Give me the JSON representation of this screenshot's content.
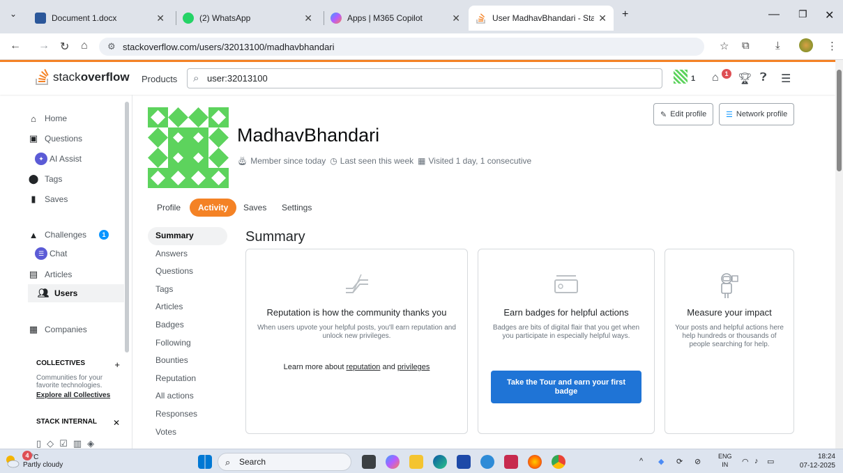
{
  "browser": {
    "tabs": [
      {
        "title": "Document 1.docx",
        "icon": "word-icon",
        "color": "#2b579a"
      },
      {
        "title": "(2) WhatsApp",
        "icon": "whatsapp-icon",
        "color": "#25d366"
      },
      {
        "title": "Apps | M365 Copilot",
        "icon": "copilot-icon",
        "color": "#7b61ff"
      },
      {
        "title": "User MadhavBhandari - Stack O",
        "icon": "stackoverflow-icon",
        "color": "#f48225"
      }
    ],
    "url": "stackoverflow.com/users/32013100/madhavbhandari"
  },
  "so_header": {
    "logo_light": "stack",
    "logo_bold": "overflow",
    "products": "Products",
    "search_value": "user:32013100",
    "reputation": "1",
    "inbox_count": "1",
    "accent": "#f48225"
  },
  "left_nav": {
    "items": [
      {
        "label": "Home",
        "icon": "home-icon"
      },
      {
        "label": "Questions",
        "icon": "questions-icon"
      },
      {
        "label": "AI Assist",
        "icon": "ai-assist-icon"
      },
      {
        "label": "Tags",
        "icon": "tag-icon"
      },
      {
        "label": "Saves",
        "icon": "bookmark-icon"
      },
      {
        "label": "Challenges",
        "icon": "challenges-icon",
        "badge": "1"
      },
      {
        "label": "Chat",
        "icon": "chat-icon"
      },
      {
        "label": "Articles",
        "icon": "articles-icon"
      },
      {
        "label": "Users",
        "icon": "users-icon"
      },
      {
        "label": "Companies",
        "icon": "companies-icon"
      }
    ],
    "collectives_title": "COLLECTIVES",
    "collectives_text": "Communities for your favorite technologies.",
    "collectives_link": "Explore all Collectives",
    "internal_title": "STACK INTERNAL"
  },
  "profile": {
    "name": "MadhavBhandari",
    "member_since": "Member since today",
    "last_seen": "Last seen this week",
    "visited": "Visited 1 day, 1 consecutive",
    "edit_profile": "Edit profile",
    "network_profile": "Network profile",
    "tabs": [
      "Profile",
      "Activity",
      "Saves",
      "Settings"
    ],
    "avatar_color": "#5dd35d"
  },
  "activity_nav": [
    "Summary",
    "Answers",
    "Questions",
    "Tags",
    "Articles",
    "Badges",
    "Following",
    "Bounties",
    "Reputation",
    "All actions",
    "Responses",
    "Votes"
  ],
  "summary": {
    "heading": "Summary",
    "cards": [
      {
        "title": "Reputation is how the community thanks you",
        "desc": "When users upvote your helpful posts, you'll earn reputation and unlock new privileges.",
        "learn_prefix": "Learn more about ",
        "link1": "reputation",
        "and": " and ",
        "link2": "privileges"
      },
      {
        "title": "Earn badges for helpful actions",
        "desc": "Badges are bits of digital flair that you get when you participate in especially helpful ways.",
        "cta": "Take the Tour and earn your first badge"
      },
      {
        "title": "Measure your impact",
        "desc": "Your posts and helpful actions here help hundreds or thousands of people searching for help."
      }
    ]
  },
  "taskbar": {
    "temperature": "15°C",
    "condition": "Partly cloudy",
    "weather_badge": "4",
    "search": "Search",
    "lang_top": "ENG",
    "lang_bottom": "IN",
    "time": "18:24",
    "date": "07-12-2025"
  }
}
